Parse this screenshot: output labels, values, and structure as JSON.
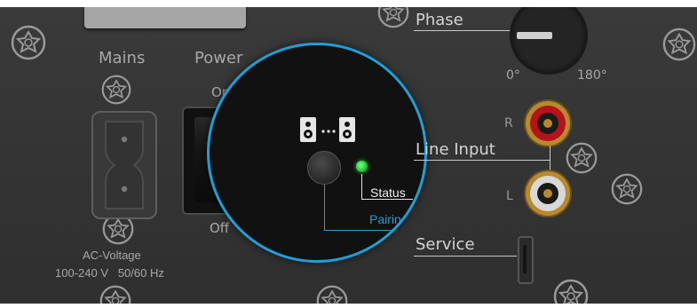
{
  "mains": {
    "label": "Mains",
    "voltage_title": "AC-Voltage",
    "voltage_value": "100-240 V   50/60 Hz"
  },
  "power": {
    "label": "Power",
    "on_label": "On",
    "off_label": "Off"
  },
  "phase": {
    "label": "Phase",
    "min_label": "0°",
    "max_label": "180°"
  },
  "line_input": {
    "label": "Line Input",
    "right_label": "R",
    "left_label": "L"
  },
  "service": {
    "label": "Service"
  },
  "callout": {
    "status_label": "Status",
    "pairing_label": "Pairing",
    "pairing_icon": "speaker-pair-icon"
  },
  "colors": {
    "accent": "#1e9fd8",
    "led": "#22c33a",
    "panel": "#353535",
    "rca_red": "#b5121b",
    "rca_white": "#d8d8d8",
    "rca_gold": "#b88a2e"
  }
}
